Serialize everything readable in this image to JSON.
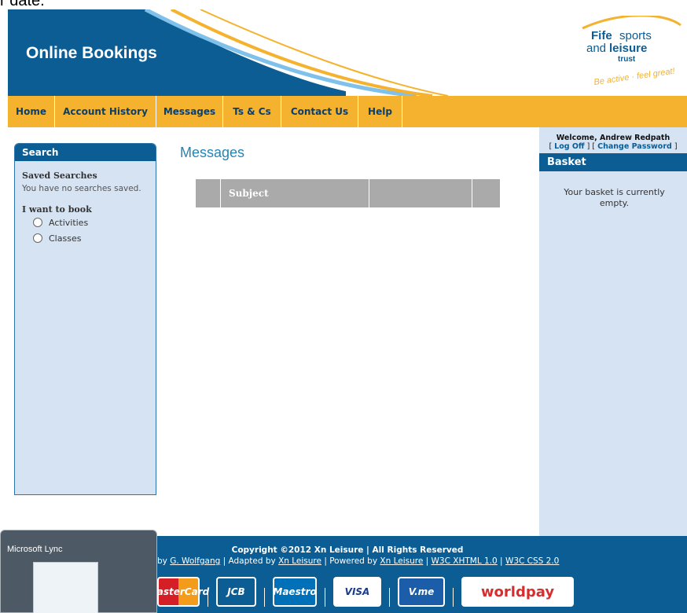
{
  "top_fragment": "r date.",
  "header": {
    "title": "Online Bookings",
    "brand_main": "Fife sports and leisure trust",
    "brand_slogan": "Be active · feel great!"
  },
  "nav": {
    "items": [
      "Home",
      "Account History",
      "Messages",
      "Ts & Cs",
      "Contact Us",
      "Help"
    ]
  },
  "sidebar": {
    "search_title": "Search",
    "saved_title": "Saved Searches",
    "saved_empty": "You have no searches saved.",
    "want_title": "I want to book",
    "options": [
      "Activities",
      "Classes"
    ]
  },
  "main": {
    "title": "Messages",
    "grid_header": "Subject"
  },
  "account": {
    "welcome": "Welcome, Andrew Redpath",
    "log_off": "Log Off",
    "change_password": "Change Password",
    "basket_title": "Basket",
    "basket_empty": "Your basket is currently empty."
  },
  "footer": {
    "copyright": "Copyright ©2012 Xn Leisure | All Rights Reserved",
    "credits_prefix": "by",
    "credit_wolfgang": "G. Wolfgang",
    "adapted_text": "| Adapted by",
    "adapted_by": "Xn Leisure",
    "powered_text": "| Powered by",
    "powered_by": "Xn Leisure",
    "w3c_html": "W3C XHTML 1.0",
    "w3c_css": "W3C CSS 2.0",
    "cards": [
      "MasterCard",
      "JCB",
      "Maestro",
      "VISA",
      "V.me",
      "worldpay"
    ]
  },
  "overlay": {
    "lync_title": "Microsoft Lync"
  },
  "colors": {
    "brand_blue": "#0b5d94",
    "nav_orange": "#f5b22e",
    "panel_blue": "#d6e3f3",
    "header_text": "#2385b5"
  }
}
